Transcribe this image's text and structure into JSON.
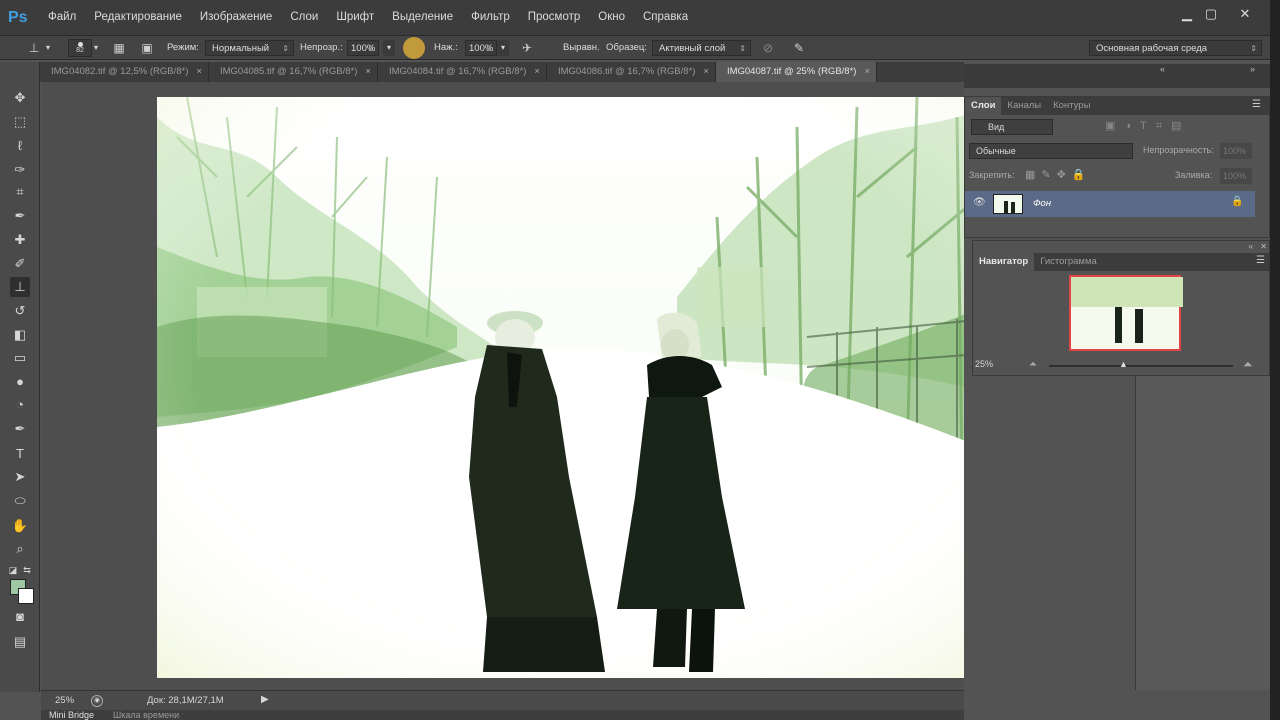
{
  "app": {
    "logo": "Ps"
  },
  "menu": [
    "Файл",
    "Редактирование",
    "Изображение",
    "Слои",
    "Шрифт",
    "Выделение",
    "Фильтр",
    "Просмотр",
    "Окно",
    "Справка"
  ],
  "window_controls": {
    "minimize": "▁",
    "maximize": "▢",
    "close": "✕"
  },
  "options": {
    "brush_size": "82",
    "mode_label": "Режим:",
    "mode_value": "Нормальный",
    "opacity_label": "Непрозр.:",
    "opacity_value": "100%",
    "pressure_label": "Наж.:",
    "pressure_value": "100%",
    "aligned_label": "Выравн.",
    "sample_label": "Образец:",
    "sample_value": "Активный слой",
    "workspace": "Основная рабочая среда"
  },
  "tabs": [
    {
      "label": "IMG04082.tif @ 12,5% (RGB/8*)",
      "active": false
    },
    {
      "label": "IMG04085.tif @ 16,7% (RGB/8*)",
      "active": false
    },
    {
      "label": "IMG04084.tif @ 16,7% (RGB/8*)",
      "active": false
    },
    {
      "label": "IMG04086.tif @ 16,7% (RGB/8*)",
      "active": false
    },
    {
      "label": "IMG04087.tif @ 25% (RGB/8*)",
      "active": true
    }
  ],
  "status": {
    "zoom": "25%",
    "doc": "Док: 28,1M/27,1M"
  },
  "bottom_tabs": [
    "Mini Bridge",
    "Шкала времени"
  ],
  "layers_panel": {
    "tabs": [
      "Слои",
      "Каналы",
      "Контуры"
    ],
    "filter_kind": "Вид",
    "blend_mode": "Обычные",
    "opacity_label": "Непрозрачность:",
    "opacity_value": "100%",
    "lock_label": "Закрепить:",
    "fill_label": "Заливка:",
    "fill_value": "100%",
    "layers": [
      {
        "name": "Фон",
        "visible": true,
        "locked": true
      }
    ]
  },
  "navigator_panel": {
    "tabs": [
      "Навигатор",
      "Гистограмма"
    ],
    "zoom": "25%"
  },
  "colors": {
    "foreground": "#9ec8a4",
    "background": "#ffffff",
    "accent": "#3fa0e0"
  }
}
